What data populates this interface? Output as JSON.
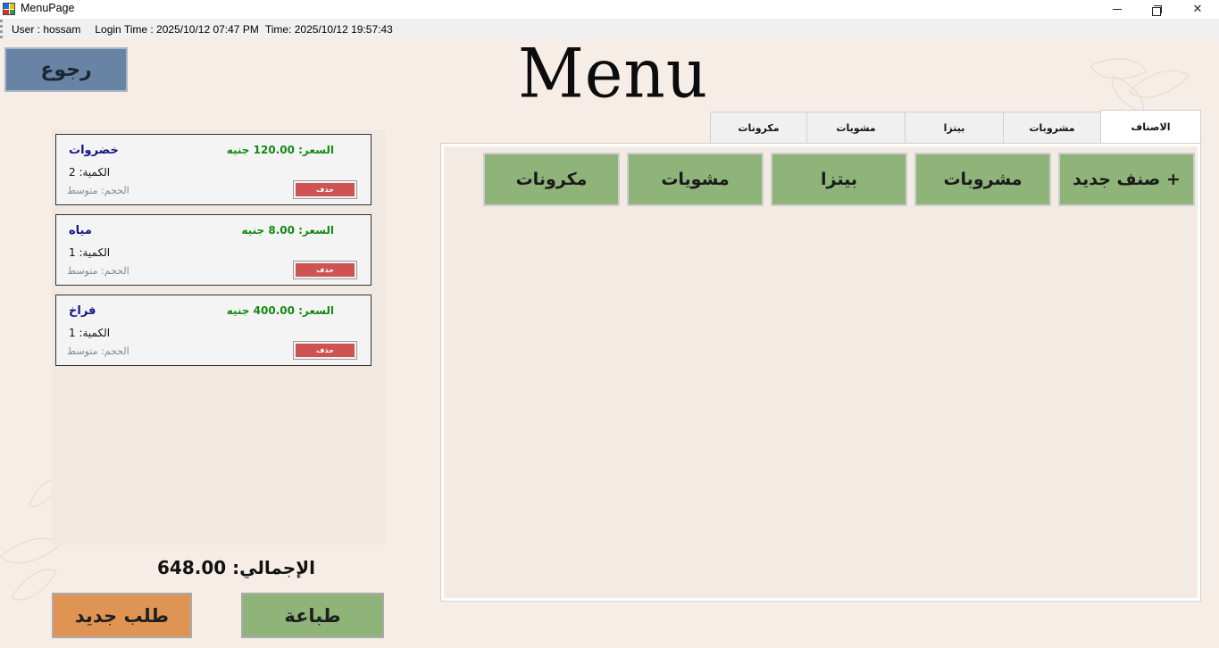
{
  "window": {
    "title": "MenuPage",
    "minimize_label": "",
    "maximize_label": "",
    "close_label": "✕"
  },
  "status": {
    "user": "User : hossam",
    "login": "Login Time :  2025/10/12 07:47 PM",
    "time": "Time: 2025/10/12 19:57:43"
  },
  "header": {
    "back_label": "رجوع",
    "title": "Menu"
  },
  "cart": {
    "items": [
      {
        "name": "خضروات",
        "price": "السعر: 120.00 جنيه",
        "qty": "الكمية: 2",
        "size": "الحجم: متوسط",
        "delete_label": "حذف"
      },
      {
        "name": "مياه",
        "price": "السعر: 8.00 جنيه",
        "qty": "الكمية: 1",
        "size": "الحجم: متوسط",
        "delete_label": "حذف"
      },
      {
        "name": "فراخ",
        "price": "السعر: 400.00 جنيه",
        "qty": "الكمية: 1",
        "size": "الحجم: متوسط",
        "delete_label": "حذف"
      }
    ],
    "total": "الإجمالي: 648.00",
    "new_order_label": "طلب جديد",
    "print_label": "طباعة"
  },
  "tabs": [
    {
      "label": "الاصناف",
      "active": true
    },
    {
      "label": "مشروبات",
      "active": false
    },
    {
      "label": "بيتزا",
      "active": false
    },
    {
      "label": "مشويات",
      "active": false
    },
    {
      "label": "مكرونات",
      "active": false
    }
  ],
  "categories": [
    {
      "label": "صنف جديد +"
    },
    {
      "label": "مشروبات"
    },
    {
      "label": "بيتزا"
    },
    {
      "label": "مشويات"
    },
    {
      "label": "مكرونات"
    }
  ],
  "colors": {
    "background": "#f5ede6",
    "back_button": "#6883a3",
    "category_button": "#8eb47a",
    "new_order_button": "#e09454",
    "delete_button": "#cf5353",
    "price_text": "#138a13",
    "item_name_text": "#151585"
  }
}
